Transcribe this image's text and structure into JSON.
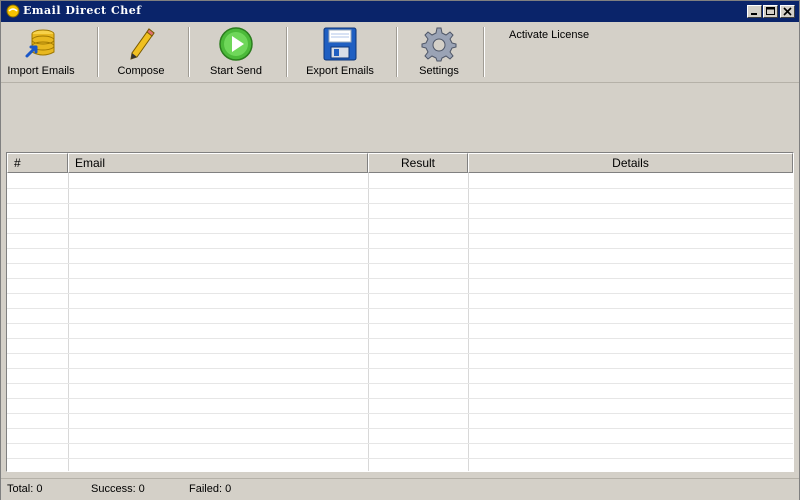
{
  "window": {
    "title": "Email Direct Chef"
  },
  "toolbar": {
    "items": [
      {
        "label": "Import Emails",
        "icon": "database-import-icon"
      },
      {
        "label": "Compose",
        "icon": "pencil-icon"
      },
      {
        "label": "Start Send",
        "icon": "play-icon"
      },
      {
        "label": "Export Emails",
        "icon": "floppy-disk-icon"
      },
      {
        "label": "Settings",
        "icon": "gear-icon"
      }
    ],
    "activate_link": "Activate License"
  },
  "grid": {
    "columns": [
      {
        "label": "#",
        "align": "left"
      },
      {
        "label": "Email",
        "align": "left"
      },
      {
        "label": "Result",
        "align": "center"
      },
      {
        "label": "Details",
        "align": "center"
      }
    ],
    "rows": []
  },
  "status": {
    "total": "Total: 0",
    "success": "Success: 0",
    "failed": "Failed: 0"
  },
  "colors": {
    "titlebar": "#0a246a",
    "window_bg": "#d4d0c8",
    "grid_bg": "#ffffff"
  }
}
